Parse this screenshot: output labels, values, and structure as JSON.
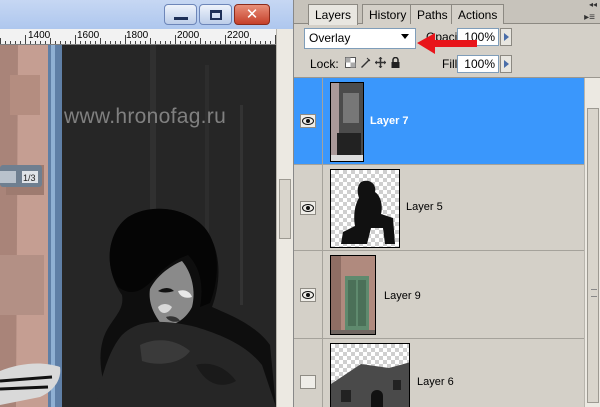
{
  "window": {
    "minimize_icon": "minimize-icon",
    "maximize_icon": "maximize-icon",
    "close_icon": "close-icon"
  },
  "ruler": {
    "labels": [
      "1400",
      "1600",
      "1800",
      "2000",
      "2200"
    ]
  },
  "canvas": {
    "watermark": "www.hronofag.ru",
    "sign_text_1": "1/3"
  },
  "panel": {
    "tabs": [
      {
        "label": "Layers",
        "active": true
      },
      {
        "label": "History",
        "active": false
      },
      {
        "label": "Paths",
        "active": false
      },
      {
        "label": "Actions",
        "active": false
      }
    ],
    "blend_mode": "Overlay",
    "opacity_label": "Opacity:",
    "opacity_value": "100%",
    "lock_label": "Lock:",
    "fill_label": "Fill:",
    "fill_value": "100%",
    "annotation_color": "#e8141a",
    "selection_color": "#3a97fc"
  },
  "layers": [
    {
      "name": "Layer 7",
      "visible": true,
      "selected": true
    },
    {
      "name": "Layer 5",
      "visible": true,
      "selected": false
    },
    {
      "name": "Layer 9",
      "visible": true,
      "selected": false
    },
    {
      "name": "Layer 6",
      "visible": false,
      "selected": false
    }
  ]
}
